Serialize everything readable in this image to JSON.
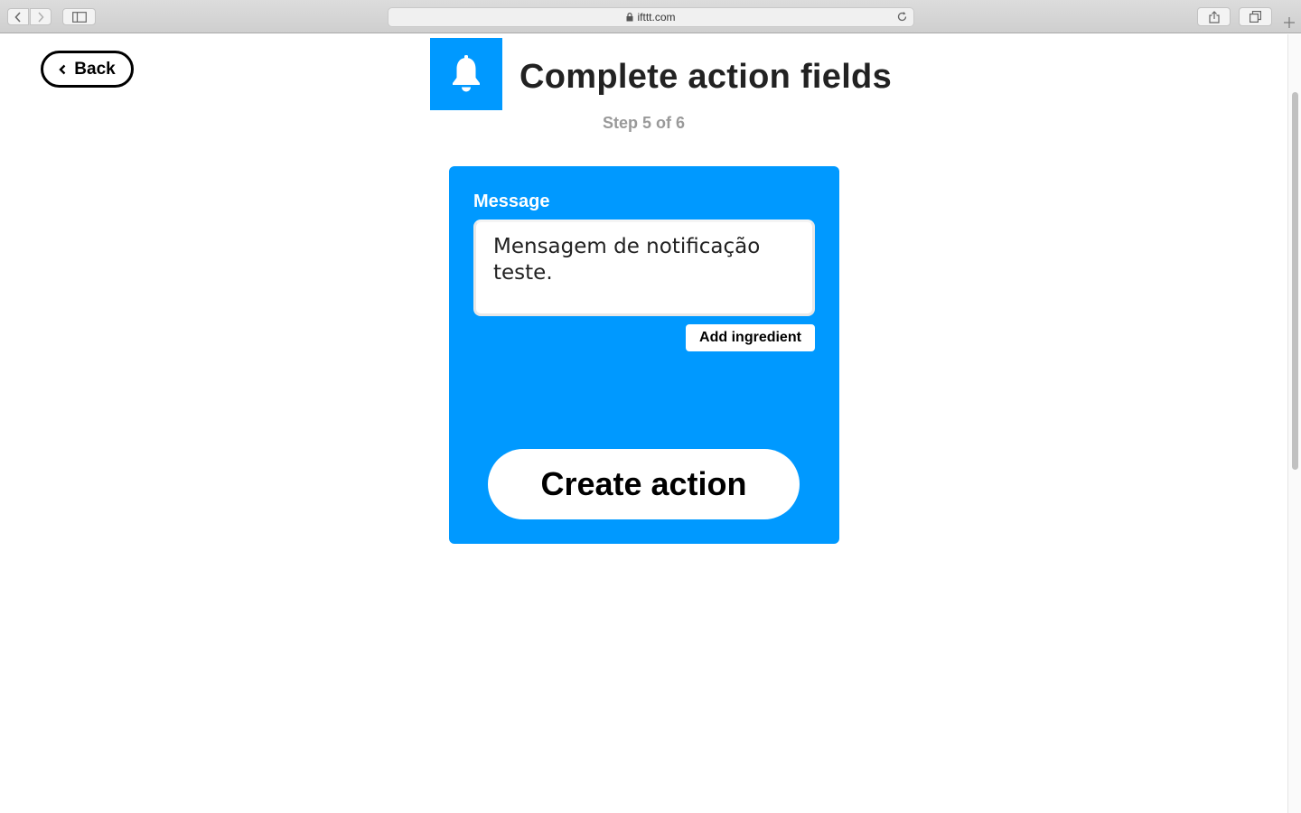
{
  "browser": {
    "url": "ifttt.com"
  },
  "header": {
    "back_label": "Back",
    "title": "Complete action fields",
    "step": "Step 5 of 6",
    "service_icon": "bell-icon",
    "service_color": "#0099ff"
  },
  "form": {
    "field_label": "Message",
    "message_value": "Mensagem de notificação teste.",
    "add_ingredient_label": "Add ingredient",
    "submit_label": "Create action"
  }
}
